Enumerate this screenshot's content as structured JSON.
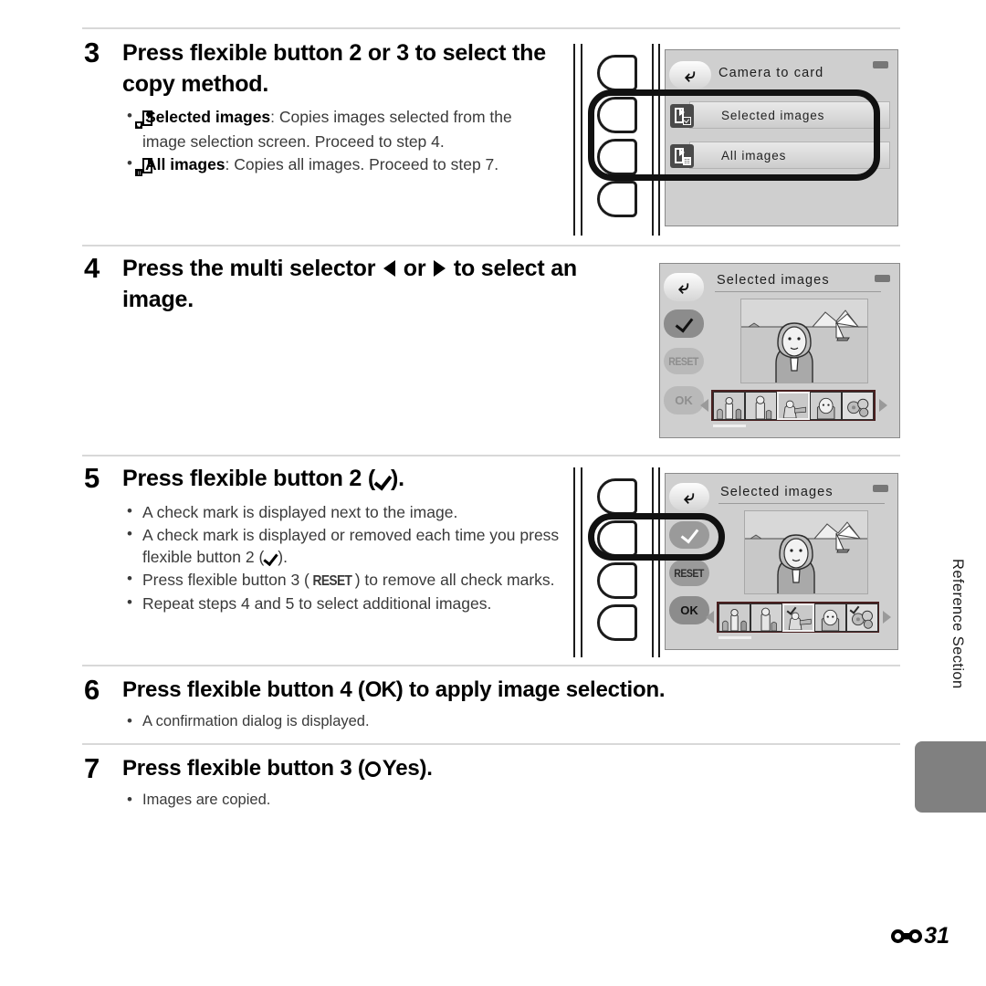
{
  "page": {
    "folio_symbol": "binoculars-icon",
    "folio_number": "31",
    "side_label": "Reference Section"
  },
  "steps": [
    {
      "number": "3",
      "heading": "Press flexible button 2 or 3 to select the copy method.",
      "bullets": [
        {
          "icon": "copy-selected-icon",
          "bold": "Selected images",
          "text": ": Copies images selected from the image selection screen. Proceed to step 4."
        },
        {
          "icon": "copy-all-icon",
          "bold": "All images",
          "text": ": Copies all images. Proceed to step 7."
        }
      ]
    },
    {
      "number": "4",
      "heading_pre": "Press the multi selector ",
      "heading_mid": " or ",
      "heading_post": " to select an image.",
      "bullets": []
    },
    {
      "number": "5",
      "heading_pre": "Press flexible button 2 (",
      "heading_post": ").",
      "bullets": [
        {
          "text": "A check mark is displayed next to the image."
        },
        {
          "text_pre": "A check mark is displayed or removed each time you press flexible button 2 (",
          "text_post": ")."
        },
        {
          "text_pre": "Press flexible button 3 (",
          "glyph": "RESET",
          "text_post": ") to remove all check marks."
        },
        {
          "text": "Repeat steps 4 and 5 to select additional images."
        }
      ]
    },
    {
      "number": "6",
      "heading_pre": "Press flexible button 4 (",
      "heading_glyph": "OK",
      "heading_post": ") to apply image selection.",
      "bullets": [
        {
          "text": "A confirmation dialog is displayed."
        }
      ]
    },
    {
      "number": "7",
      "heading_pre": "Press flexible button 3 (",
      "heading_bold": "Yes",
      "heading_post": ").",
      "bullets": [
        {
          "text": "Images are copied."
        }
      ]
    }
  ],
  "screens": {
    "copy_menu": {
      "title": "Camera to card",
      "back_icon": "back-arrow-icon",
      "battery_icon": "battery-icon",
      "items": [
        {
          "label": "Selected images",
          "icon": "copy-selected-icon"
        },
        {
          "label": "All images",
          "icon": "copy-all-icon"
        }
      ]
    },
    "select_image_step4": {
      "title": "Selected images",
      "battery_icon": "battery-icon",
      "softkeys": [
        {
          "name": "back",
          "label": "",
          "icon": "back-arrow-icon",
          "state": "light"
        },
        {
          "name": "check",
          "label": "",
          "icon": "check-icon",
          "state": "active"
        },
        {
          "name": "reset",
          "label": "RESET",
          "state": "dim"
        },
        {
          "name": "ok",
          "label": "OK",
          "state": "dim"
        }
      ],
      "thumbnails": [
        {
          "checked": false,
          "selected": false
        },
        {
          "checked": false,
          "selected": false
        },
        {
          "checked": false,
          "selected": true
        },
        {
          "checked": false,
          "selected": false
        },
        {
          "checked": false,
          "selected": false
        }
      ]
    },
    "select_image_step5": {
      "title": "Selected images",
      "battery_icon": "battery-icon",
      "softkeys": [
        {
          "name": "back",
          "label": "",
          "icon": "back-arrow-icon",
          "state": "light"
        },
        {
          "name": "check",
          "label": "",
          "icon": "check-icon",
          "state": "highlighted"
        },
        {
          "name": "reset",
          "label": "RESET",
          "state": "mid"
        },
        {
          "name": "ok",
          "label": "OK",
          "state": "dark"
        }
      ],
      "thumbnails": [
        {
          "checked": false,
          "selected": false
        },
        {
          "checked": false,
          "selected": false
        },
        {
          "checked": true,
          "selected": true
        },
        {
          "checked": false,
          "selected": false
        },
        {
          "checked": true,
          "selected": false
        }
      ]
    }
  },
  "camera_body": {
    "flexible_buttons": [
      "1",
      "2",
      "3",
      "4"
    ]
  }
}
